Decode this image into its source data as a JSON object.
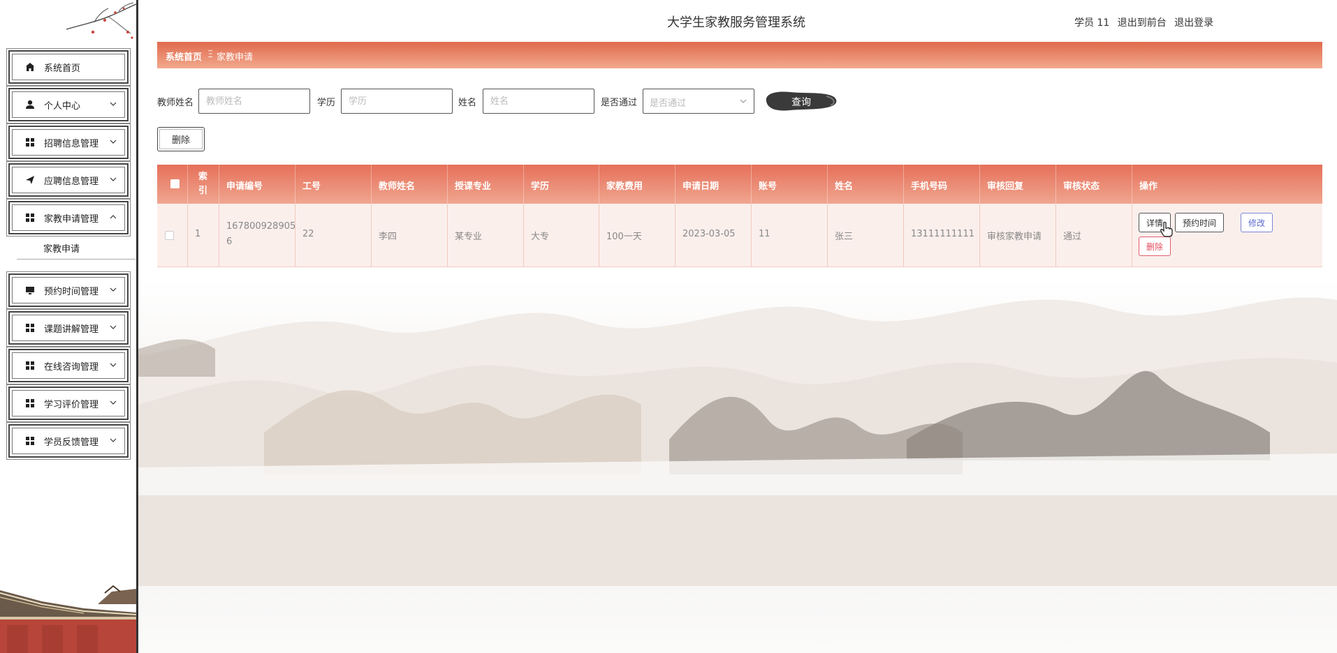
{
  "header": {
    "title": "大学生家教服务管理系统",
    "user": "学员 11",
    "to_front": "退出到前台",
    "logout": "退出登录"
  },
  "sidebar": {
    "items": [
      {
        "label": "系统首页",
        "icon": "home-icon"
      },
      {
        "label": "个人中心",
        "icon": "person-icon"
      },
      {
        "label": "招聘信息管理",
        "icon": "grid-icon"
      },
      {
        "label": "应聘信息管理",
        "icon": "send-icon"
      },
      {
        "label": "家教申请管理",
        "icon": "grid-icon",
        "expanded": true
      },
      {
        "label": "预约时间管理",
        "icon": "monitor-icon"
      },
      {
        "label": "课题讲解管理",
        "icon": "grid-icon"
      },
      {
        "label": "在线咨询管理",
        "icon": "grid-icon"
      },
      {
        "label": "学习评价管理",
        "icon": "grid-icon"
      },
      {
        "label": "学员反馈管理",
        "icon": "grid-icon"
      }
    ],
    "subitem": "家教申请"
  },
  "breadcrumb": {
    "home": "系统首页",
    "separator": "Ξ",
    "current": "家教申请"
  },
  "search": {
    "teacher_label": "教师姓名",
    "teacher_placeholder": "教师姓名",
    "edu_label": "学历",
    "edu_placeholder": "学历",
    "name_label": "姓名",
    "name_placeholder": "姓名",
    "pass_label": "是否通过",
    "pass_placeholder": "是否通过",
    "query_button": "查询"
  },
  "toolbar": {
    "delete_label": "删除"
  },
  "table": {
    "columns": [
      "索引",
      "申请编号",
      "工号",
      "教师姓名",
      "授课专业",
      "学历",
      "家教费用",
      "申请日期",
      "账号",
      "姓名",
      "手机号码",
      "审核回复",
      "审核状态",
      "操作"
    ],
    "rows": [
      {
        "index": "1",
        "apply_no_1": "167800928905",
        "apply_no_2": "6",
        "job_no": "22",
        "teacher": "李四",
        "major": "某专业",
        "education": "大专",
        "fee": "100一天",
        "date": "2023-03-05",
        "account": "11",
        "name": "张三",
        "phone": "13111111111",
        "reply": "审核家教申请",
        "status": "通过"
      }
    ],
    "actions": {
      "detail": "详情",
      "schedule": "预约时间",
      "edit": "修改",
      "delete": "删除"
    }
  },
  "colors": {
    "accent": "#e06a4d",
    "accent_light": "#f2a98d",
    "row_bg": "#fbefec",
    "edit": "#5c6bd3",
    "danger": "#e14c5f"
  }
}
